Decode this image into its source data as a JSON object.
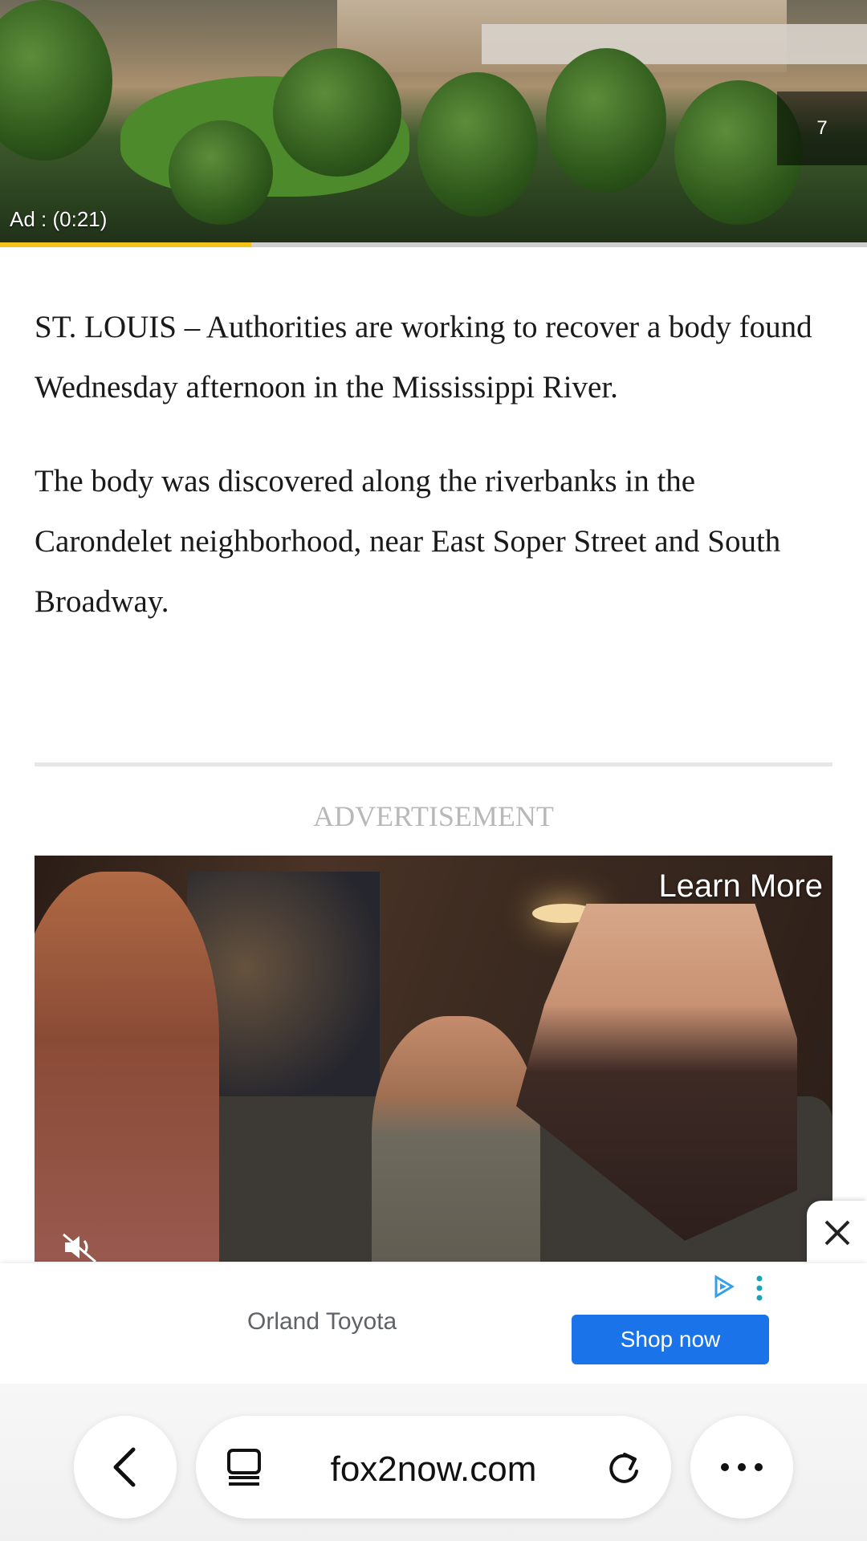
{
  "video_ad": {
    "counter": "7",
    "ad_time": "Ad : (0:21)",
    "progress": 0.29
  },
  "article": {
    "paragraphs": [
      "ST. LOUIS – Authorities are working to recover a body found Wednesday afternoon in the Mississippi River.",
      "The body was discovered along the riverbanks in the Carondelet neighborhood, near East Soper Street and South Broadway."
    ]
  },
  "advertisement": {
    "label": "ADVERTISEMENT",
    "learn_more": "Learn More",
    "mute_icon": "muted-speaker-icon",
    "close_icon": "close-icon"
  },
  "banner": {
    "advertiser": "Orland Toyota",
    "cta": "Shop now",
    "adchoices_icon": "adchoices-icon",
    "menu_icon": "more-vertical-icon",
    "brand_color": "#1a73e8"
  },
  "browser": {
    "url": "fox2now.com",
    "back_icon": "chevron-left-icon",
    "reader_icon": "reader-mode-icon",
    "reload_icon": "reload-icon",
    "more_icon": "more-horizontal-icon"
  }
}
